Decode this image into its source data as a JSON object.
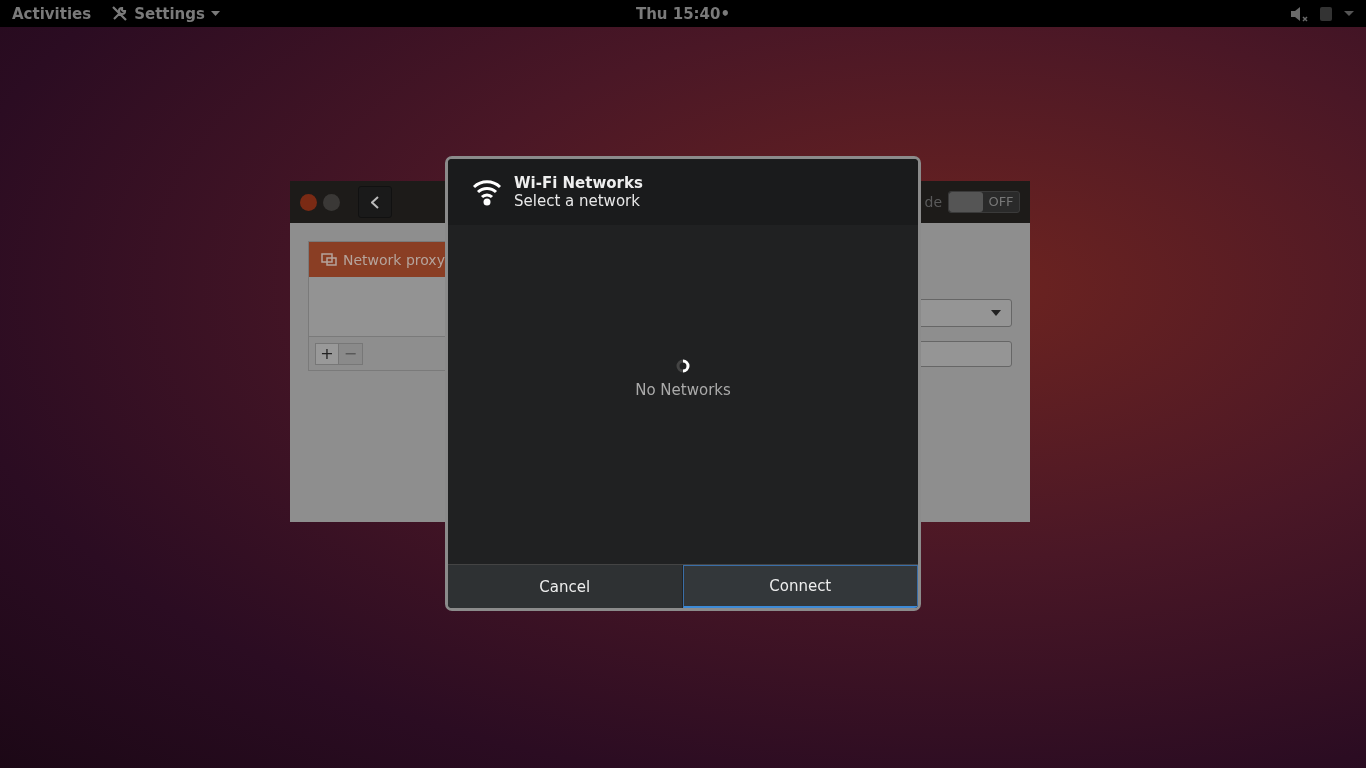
{
  "top_bar": {
    "activities": "Activities",
    "app_menu": "Settings",
    "clock": "Thu 15:40•"
  },
  "background_window": {
    "sidebar_items": [
      {
        "label": "Network proxy",
        "selected": true
      }
    ],
    "add_button": "+",
    "remove_button": "−",
    "airplane_mode_label": "de",
    "airplane_toggle": {
      "on": false,
      "label": "OFF"
    }
  },
  "dialog": {
    "title": "Wi-Fi Networks",
    "subtitle": "Select a network",
    "status": "No Networks",
    "buttons": [
      {
        "label": "Cancel",
        "default": false
      },
      {
        "label": "Connect",
        "default": true
      }
    ]
  }
}
